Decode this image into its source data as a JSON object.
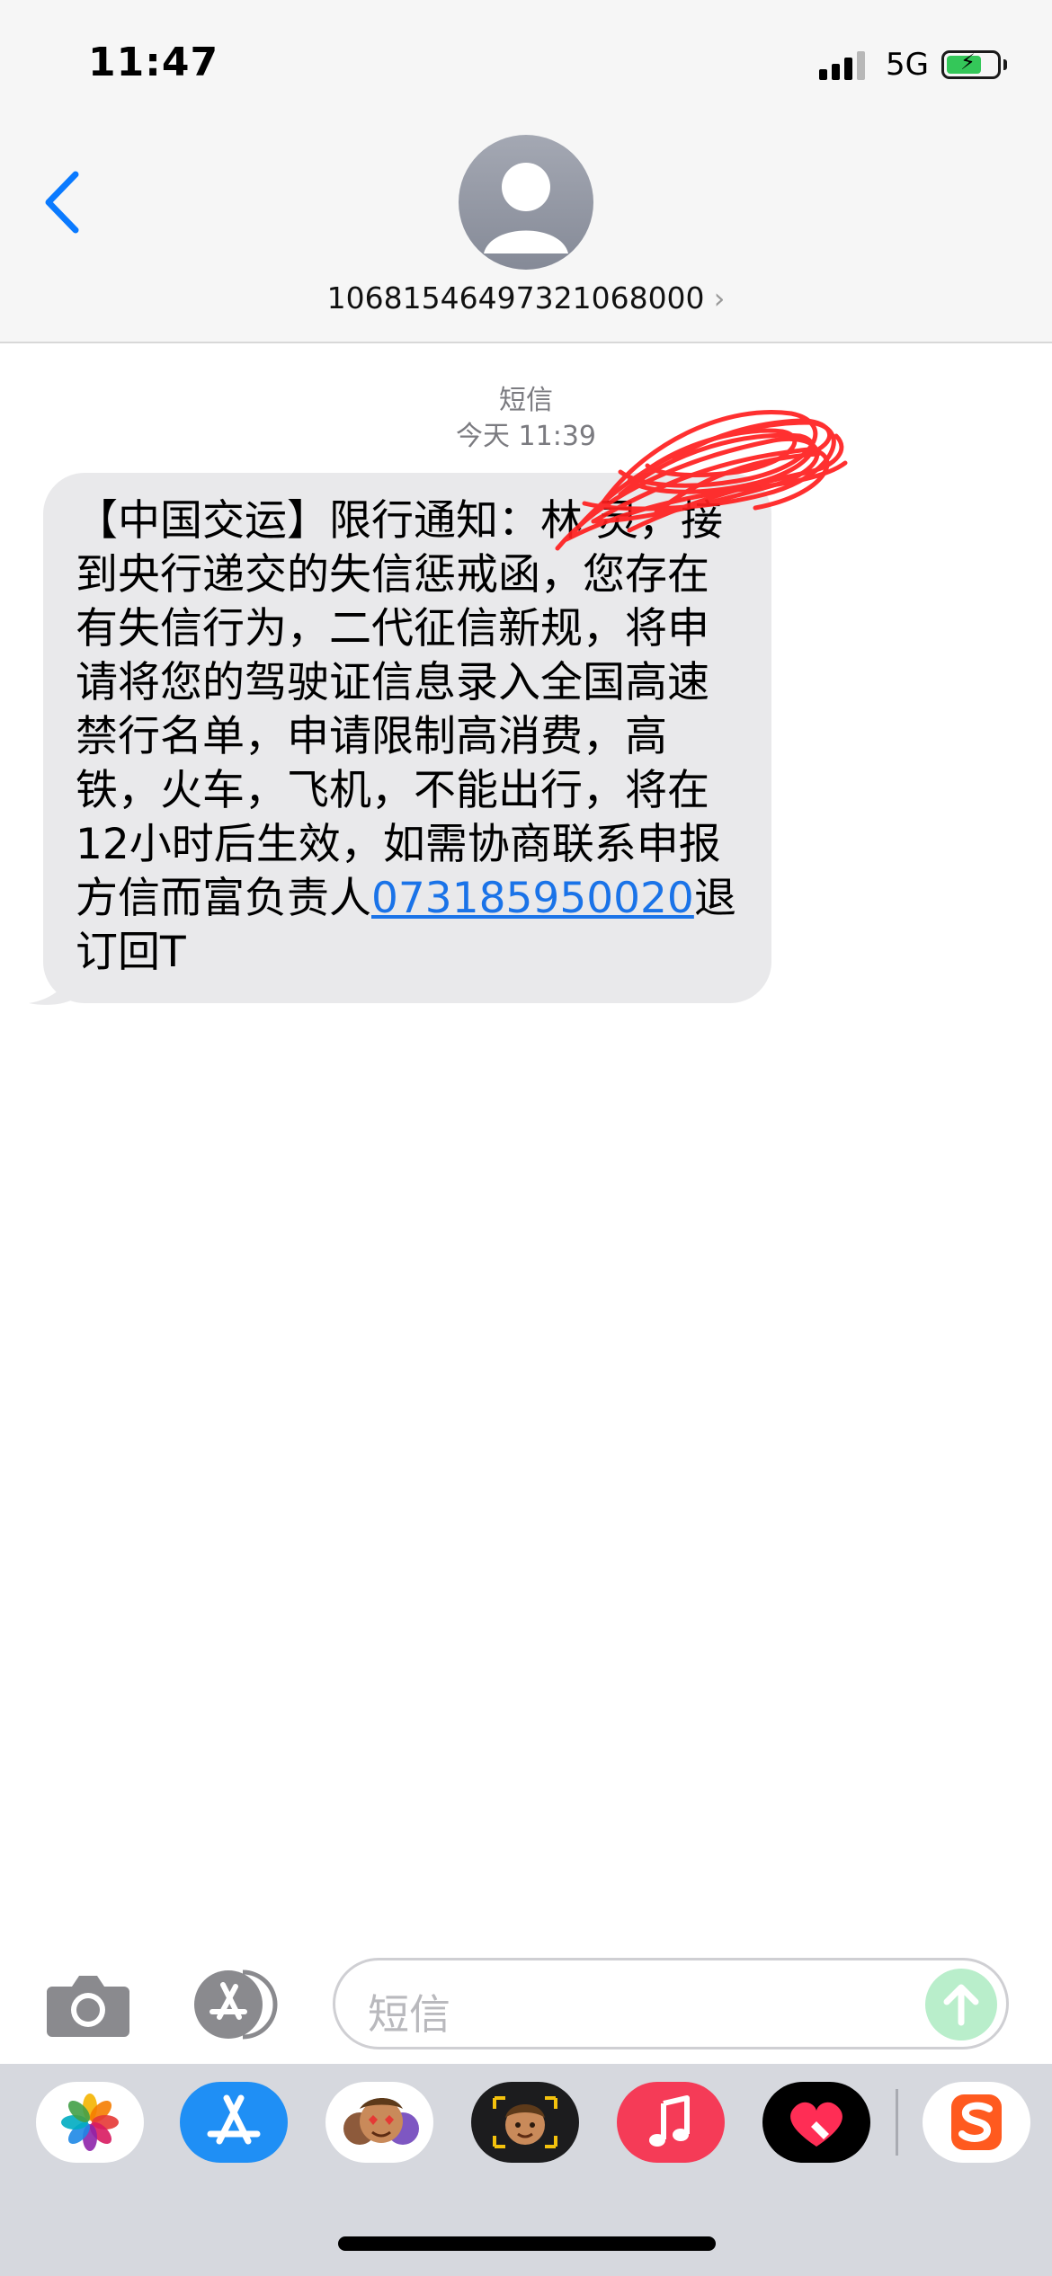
{
  "status_bar": {
    "time": "11:47",
    "network": "5G"
  },
  "header": {
    "contact_number": "10681546497321068000",
    "contact_chevron": "›"
  },
  "conversation": {
    "service_label": "短信",
    "timestamp": "今天 11:39",
    "message": {
      "text_before_link": "【中国交运】限行通知：林 灵，接到央行递交的失信惩戒函，您存在有失信行为，二代征信新规，将申请将您的驾驶证信息录入全国高速禁行名单，申请限制高消费，高铁，火车，飞机，不能出行，将在12小时后生效，如需协商联系申报方信而富负责人",
      "link": "073185950020",
      "text_after_link": "退订回T"
    }
  },
  "compose": {
    "placeholder": "短信"
  },
  "colors": {
    "header_bg": "#f6f6f6",
    "bubble_bg": "#e9e9eb",
    "accent_blue": "#1a73e8",
    "send_green": "#b9eecb",
    "drawer_bg": "#d6d8de",
    "scribble_red": "#ff1f1f"
  },
  "icons": {
    "back": "chevron-left-icon",
    "avatar": "person-icon",
    "camera": "camera-icon",
    "apps": "app-store-icon",
    "send": "arrow-up-icon",
    "drawer_apps": [
      "photos-icon",
      "app-store-icon",
      "memoji-stickers-icon",
      "memoji-icon",
      "music-icon",
      "digital-touch-icon",
      "sogou-icon"
    ]
  }
}
